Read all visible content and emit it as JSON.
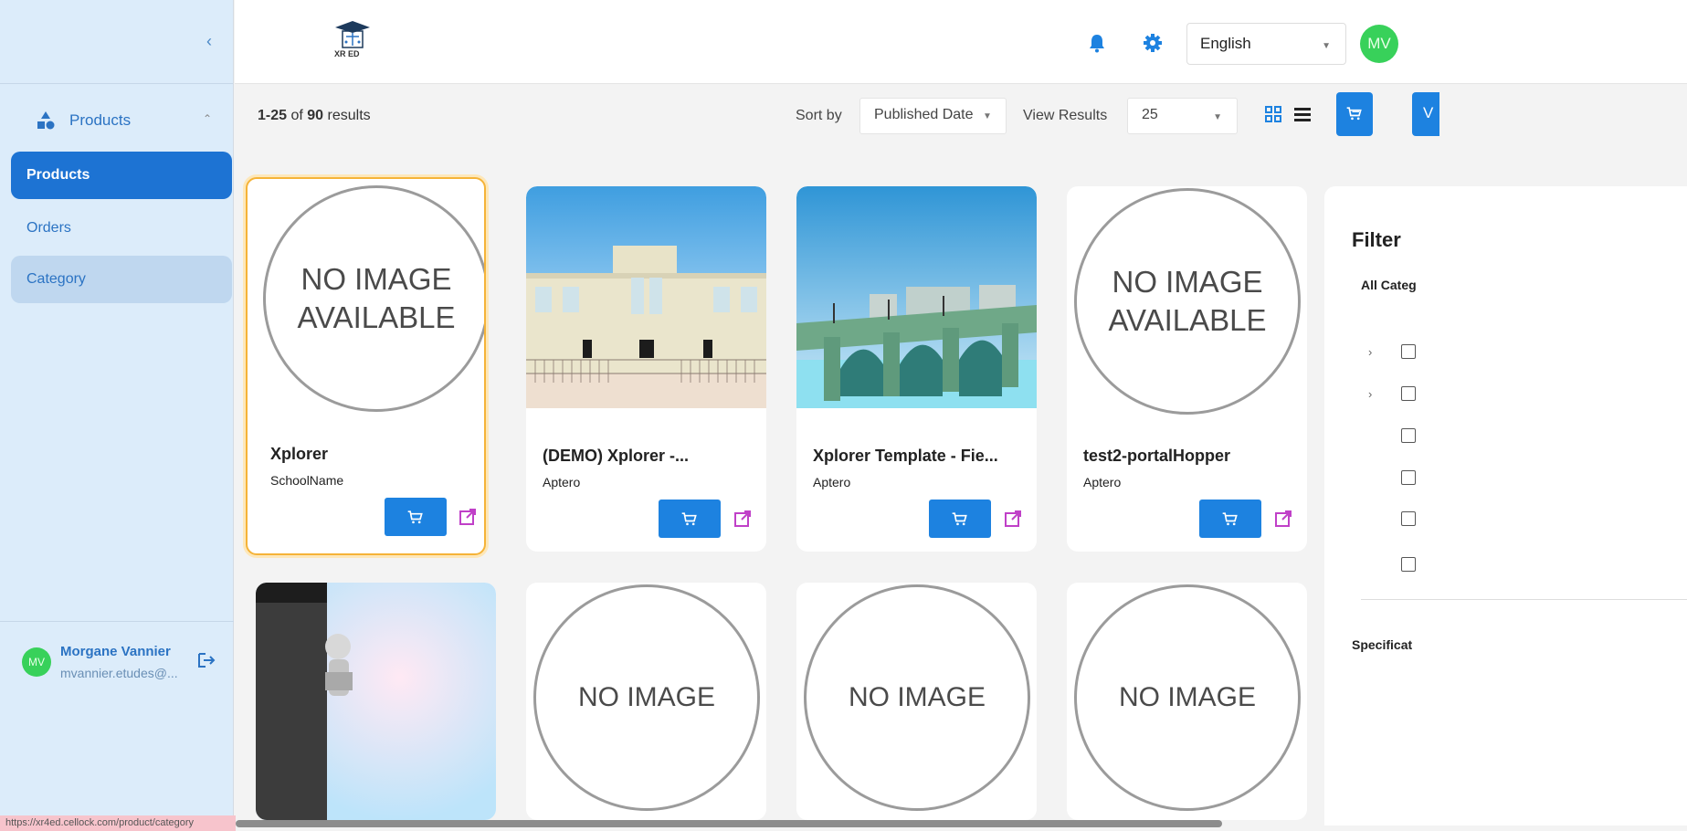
{
  "sidebar": {
    "section_label": "Products",
    "items": [
      {
        "label": "Products"
      },
      {
        "label": "Orders"
      },
      {
        "label": "Category"
      }
    ],
    "user": {
      "initials": "MV",
      "name": "Morgane Vannier",
      "email": "mvannier.etudes@..."
    }
  },
  "status_url": "https://xr4ed.cellock.com/product/category",
  "header": {
    "logo_text": "XR ED",
    "language": "English",
    "avatar_initials": "MV"
  },
  "toolbar": {
    "range": "1-25",
    "of": "of",
    "total": "90",
    "results_word": "results",
    "sort_label": "Sort by",
    "sort_value": "Published Date",
    "view_label": "View Results",
    "view_value": "25"
  },
  "cards": [
    {
      "title": "Xplorer",
      "subtitle": "SchoolName",
      "placeholder": "NO IMAGE AVAILABLE"
    },
    {
      "title": "(DEMO) Xplorer -...",
      "subtitle": "Aptero"
    },
    {
      "title": "Xplorer Template - Fie...",
      "subtitle": "Aptero"
    },
    {
      "title": "test2-portalHopper",
      "subtitle": "Aptero",
      "placeholder": "NO IMAGE AVAILABLE"
    },
    {
      "placeholder": "NO IMAGE"
    },
    {
      "placeholder": "NO IMAGE"
    },
    {
      "placeholder": "NO IMAGE"
    }
  ],
  "filter": {
    "title": "Filter",
    "all_categories": "All Categ",
    "specifications": "Specificat"
  },
  "colors": {
    "accent": "#1d82e0",
    "sidebar_bg": "#dcecfa",
    "avatar": "#38d15a",
    "selection": "#f5b338"
  }
}
